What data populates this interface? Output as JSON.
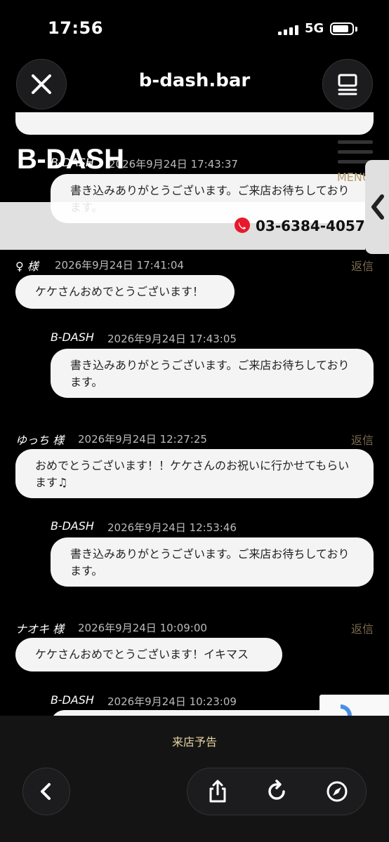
{
  "status": {
    "time": "17:56",
    "network": "5G"
  },
  "nav": {
    "url": "b-dash.bar",
    "close_icon": "close-icon",
    "tabs_icon": "tabs-icon"
  },
  "header": {
    "logo": "B-DASH",
    "menu_label": "MENU",
    "phone": "03-6384-4057"
  },
  "comments": [
    {
      "reply": {
        "author": "B-DASH",
        "date": "2026年9月24日 17:43:37",
        "text": "書き込みありがとうございます。ご来店お待ちしております。"
      }
    },
    {
      "author": "♀ 様",
      "date": "2026年9月24日 17:41:04",
      "reply_label": "返信",
      "text": "ケケさんおめでとうございます！",
      "reply": {
        "author": "B-DASH",
        "date": "2026年9月24日 17:43:05",
        "text": "書き込みありがとうございます。ご来店お待ちしております。"
      }
    },
    {
      "author": "ゆっち 様",
      "date": "2026年9月24日 12:27:25",
      "reply_label": "返信",
      "text": "おめでとうございます！！ケケさんのお祝いに行かせてもらいます♫",
      "reply": {
        "author": "B-DASH",
        "date": "2026年9月24日 12:53:46",
        "text": "書き込みありがとうございます。ご来店お待ちしております。"
      }
    },
    {
      "author": "ナオキ 様",
      "date": "2026年9月24日 10:09:00",
      "reply_label": "返信",
      "text": "ケケさんおめでとうございます！イキマス",
      "reply": {
        "author": "B-DASH",
        "date": "2026年9月24日 10:23:09"
      }
    }
  ],
  "toolbar": {
    "notice": "来店予告"
  },
  "colors": {
    "accent_gold": "#b59b6a",
    "phone_red": "#e8192c",
    "bubble": "#f4f4f4"
  }
}
